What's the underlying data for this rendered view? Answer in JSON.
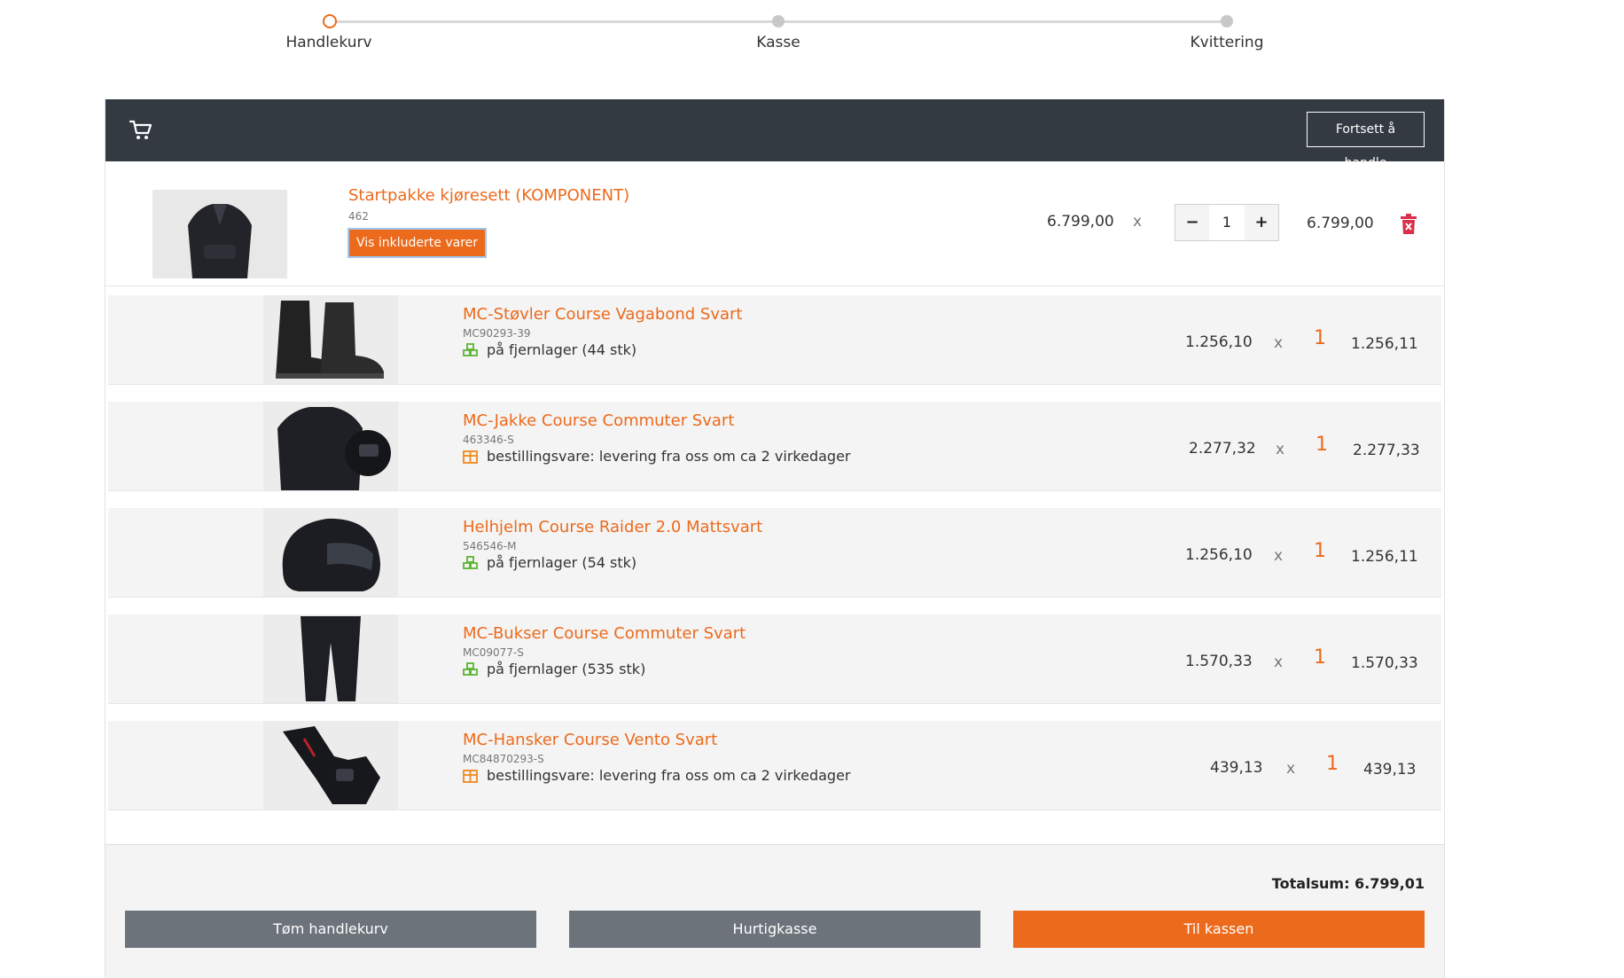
{
  "stepper": {
    "steps": [
      {
        "label": "Handlekurv"
      },
      {
        "label": "Kasse"
      },
      {
        "label": "Kvittering"
      }
    ]
  },
  "header": {
    "continue_label": "Fortsett å handle"
  },
  "main_item": {
    "name": "Startpakke kjøresett (KOMPONENT)",
    "sku": "462",
    "show_included_label": "Vis inkluderte varer",
    "unit_price": "6.799,00",
    "times": "x",
    "qty_minus": "−",
    "qty": "1",
    "qty_plus": "+",
    "total": "6.799,00"
  },
  "sub_items": [
    {
      "name": "MC-Støvler Course Vagabond Svart",
      "sku": "MC90293-39",
      "stock_icon": "remote-stock-icon",
      "stock": "på fjernlager (44 stk)",
      "unit_price": "1.256,10",
      "times": "x",
      "qty": "1",
      "total": "1.256,11"
    },
    {
      "name": "MC-Jakke Course Commuter Svart",
      "sku": "463346-S",
      "stock_icon": "order-item-icon",
      "stock": "bestillingsvare: levering fra oss om ca 2 virkedager",
      "unit_price": "2.277,32",
      "times": "x",
      "qty": "1",
      "total": "2.277,33"
    },
    {
      "name": "Helhjelm Course Raider 2.0 Mattsvart",
      "sku": "546546-M",
      "stock_icon": "remote-stock-icon",
      "stock": "på fjernlager (54 stk)",
      "unit_price": "1.256,10",
      "times": "x",
      "qty": "1",
      "total": "1.256,11"
    },
    {
      "name": "MC-Bukser Course Commuter Svart",
      "sku": "MC09077-S",
      "stock_icon": "remote-stock-icon",
      "stock": "på fjernlager (535 stk)",
      "unit_price": "1.570,33",
      "times": "x",
      "qty": "1",
      "total": "1.570,33"
    },
    {
      "name": "MC-Hansker Course Vento Svart",
      "sku": "MC84870293-S",
      "stock_icon": "order-item-icon",
      "stock": "bestillingsvare: levering fra oss om ca 2 virkedager",
      "unit_price": "439,13",
      "times": "x",
      "qty": "1",
      "total": "439,13"
    }
  ],
  "footer": {
    "total": "Totalsum: 6.799,01",
    "empty_label": "Tøm handlekurv",
    "quick_label": "Hurtigkasse",
    "checkout_label": "Til kassen"
  },
  "colors": {
    "accent": "#ec6a1c",
    "header_bg": "#343a42",
    "button_gray": "#6c737b",
    "stock_green": "#5bb531",
    "order_orange": "#f08a1c",
    "delete_red": "#d9304a"
  }
}
